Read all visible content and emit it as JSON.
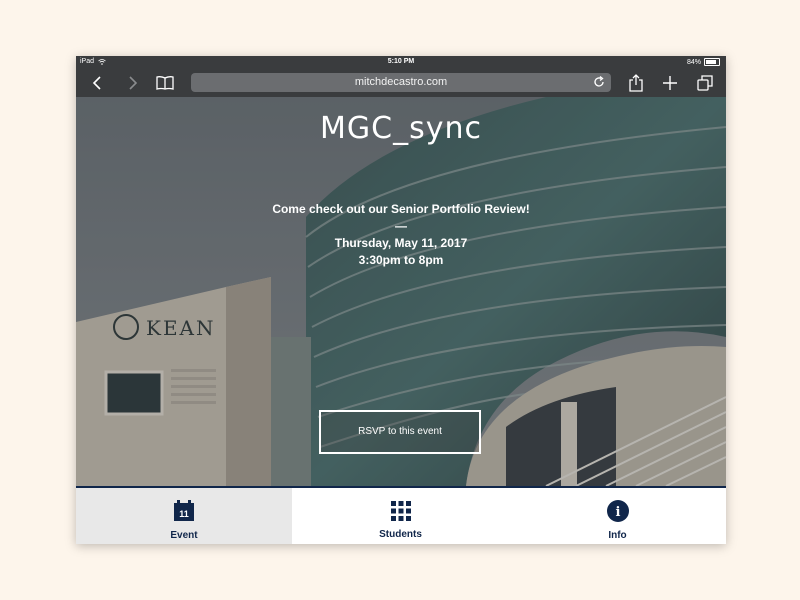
{
  "status_bar": {
    "device": "iPad",
    "time": "5:10 PM",
    "battery": "84%"
  },
  "browser": {
    "url": "mitchdecastro.com",
    "icons": [
      "back-icon",
      "forward-icon",
      "bookmarks-icon",
      "reload-icon",
      "share-icon",
      "add-tab-icon",
      "tabs-icon"
    ]
  },
  "hero": {
    "title": "MGC_sync",
    "line1": "Come check out our Senior Portfolio Review!",
    "dash": "—",
    "date": "Thursday, May 11, 2017",
    "time": "3:30pm to 8pm",
    "building_sign": "KEAN",
    "rsvp_label": "RSVP to this event"
  },
  "tabs": [
    {
      "label": "Event",
      "icon": "calendar-icon",
      "calendar_day": "11",
      "active": true
    },
    {
      "label": "Students",
      "icon": "grid-icon",
      "active": false
    },
    {
      "label": "Info",
      "icon": "info-icon",
      "icon_glyph": "i",
      "active": false
    }
  ],
  "colors": {
    "page_background": "#fdf5eb",
    "chrome": "#3a3c3e",
    "accent_navy": "#10264a",
    "active_tab_bg": "#e8e8e8"
  }
}
